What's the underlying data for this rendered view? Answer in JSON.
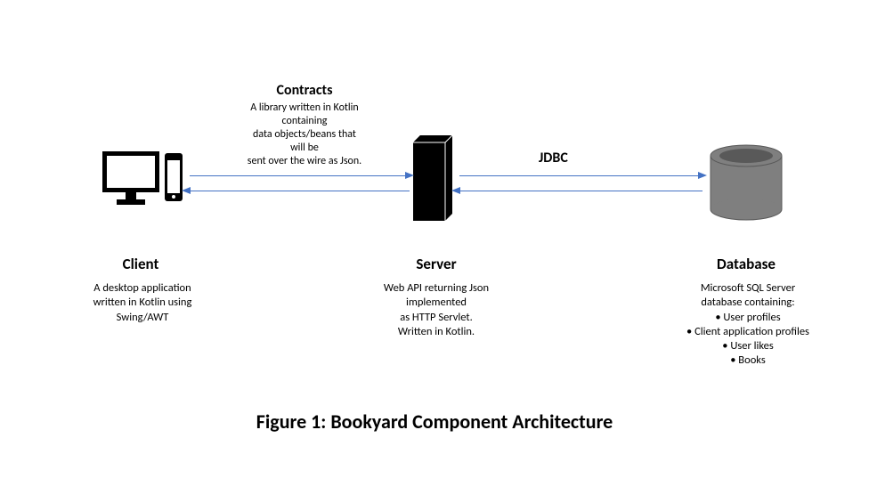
{
  "contracts": {
    "title": "Contracts",
    "desc_l1": "A library written in Kotlin",
    "desc_l2": "containing",
    "desc_l3": "data objects/beans that",
    "desc_l4": "will be",
    "desc_l5": "sent over the wire as Json."
  },
  "jdbc": "JDBC",
  "client": {
    "title": "Client",
    "desc_l1": "A desktop application",
    "desc_l2": "written in Kotlin using",
    "desc_l3": "Swing/AWT"
  },
  "server": {
    "title": "Server",
    "desc_l1": "Web API returning Json",
    "desc_l2": "implemented",
    "desc_l3": "as HTTP Servlet.",
    "desc_l4": "Written in Kotlin."
  },
  "database": {
    "title": "Database",
    "desc_l1": "Microsoft SQL Server",
    "desc_l2": "database containing:",
    "items": {
      "0": "User profiles",
      "1": "Client application profiles",
      "2": "User likes",
      "3": "Books"
    }
  },
  "caption": "Figure 1: Bookyard Component Architecture"
}
